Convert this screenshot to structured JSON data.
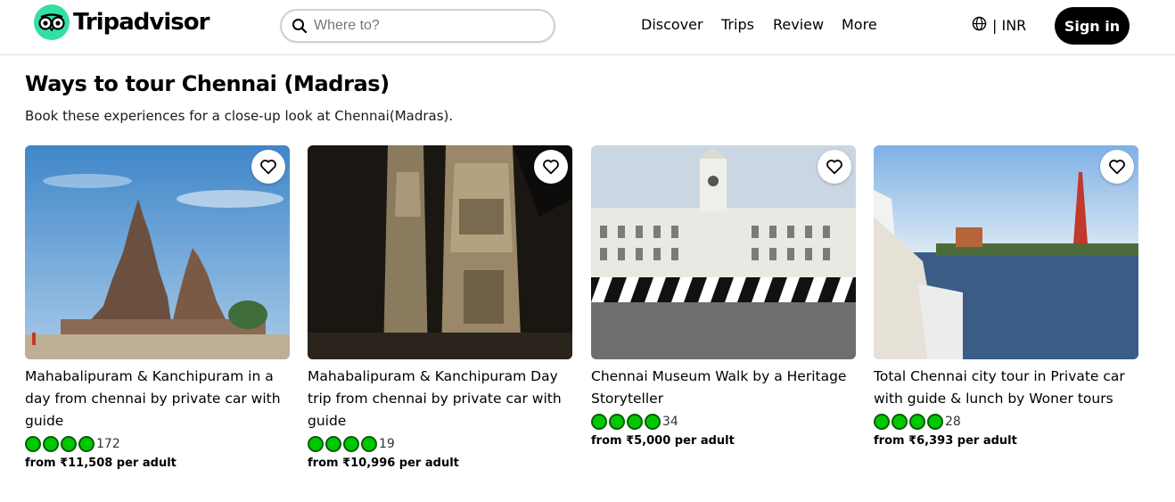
{
  "header": {
    "logo_text": "Tripadvisor",
    "search_placeholder": "Where to?",
    "nav": [
      "Discover",
      "Trips",
      "Review",
      "More"
    ],
    "currency": "| INR",
    "sign_in": "Sign in"
  },
  "section": {
    "title": "Ways to tour Chennai (Madras)",
    "subtitle": "Book these experiences for a close-up look at Chennai(Madras)."
  },
  "cards": [
    {
      "title": "Mahabalipuram & Kanchipuram in a day from chennai by private car with guide",
      "reviews": "172",
      "price": "from ₹11,508 per adult",
      "bubbles": 4
    },
    {
      "title": "Mahabalipuram & Kanchipuram Day trip from chennai by private car with guide",
      "reviews": "19",
      "price": "from ₹10,996 per adult",
      "bubbles": 4
    },
    {
      "title": "Chennai Museum Walk by a Heritage Storyteller",
      "reviews": "34",
      "price": "from ₹5,000 per adult",
      "bubbles": 4
    },
    {
      "title": "Total Chennai city tour in Private car with guide & lunch by Woner tours",
      "reviews": "28",
      "price": "from ₹6,393 per adult",
      "bubbles": 4
    }
  ],
  "colors": {
    "brand": "#34e0a1",
    "bubble": "#00c800",
    "sign_in_bg": "#000000"
  },
  "icons": [
    "owl-logo-icon",
    "search-icon",
    "globe-icon",
    "heart-icon",
    "rating-bubble-icon"
  ]
}
